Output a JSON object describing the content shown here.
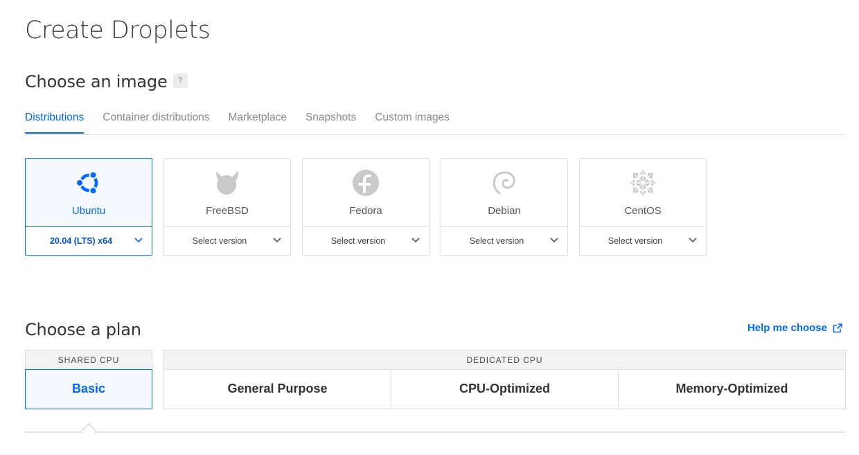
{
  "page": {
    "title": "Create Droplets"
  },
  "image_section": {
    "title": "Choose an image",
    "help_icon": "?",
    "tabs": [
      {
        "label": "Distributions",
        "active": true
      },
      {
        "label": "Container distributions",
        "active": false
      },
      {
        "label": "Marketplace",
        "active": false
      },
      {
        "label": "Snapshots",
        "active": false
      },
      {
        "label": "Custom images",
        "active": false
      }
    ],
    "distros": [
      {
        "name": "Ubuntu",
        "version": "20.04 (LTS) x64",
        "selected": true,
        "icon": "ubuntu-logo-icon"
      },
      {
        "name": "FreeBSD",
        "version": "Select version",
        "selected": false,
        "icon": "freebsd-logo-icon"
      },
      {
        "name": "Fedora",
        "version": "Select version",
        "selected": false,
        "icon": "fedora-logo-icon"
      },
      {
        "name": "Debian",
        "version": "Select version",
        "selected": false,
        "icon": "debian-logo-icon"
      },
      {
        "name": "CentOS",
        "version": "Select version",
        "selected": false,
        "icon": "centos-logo-icon"
      }
    ]
  },
  "plan_section": {
    "title": "Choose a plan",
    "help_link": "Help me choose",
    "groups": [
      {
        "label": "SHARED CPU",
        "plans": [
          {
            "label": "Basic",
            "selected": true
          }
        ]
      },
      {
        "label": "DEDICATED CPU",
        "plans": [
          {
            "label": "General Purpose",
            "selected": false
          },
          {
            "label": "CPU-Optimized",
            "selected": false
          },
          {
            "label": "Memory-Optimized",
            "selected": false
          }
        ]
      }
    ]
  },
  "colors": {
    "accent": "#0069ff",
    "muted_icon": "#c9c9c9",
    "border": "#dfdfdf"
  }
}
